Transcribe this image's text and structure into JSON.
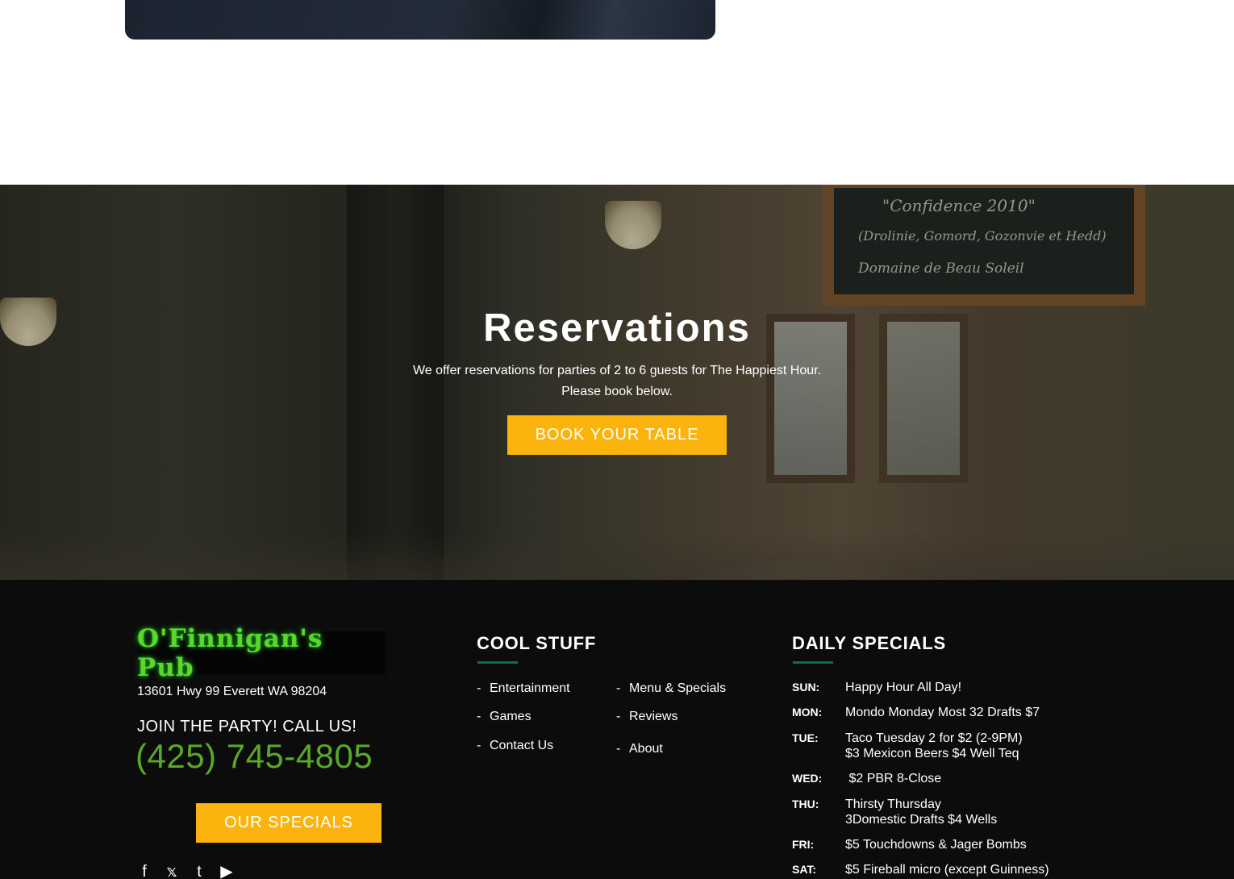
{
  "hero": {
    "title": "Reservations",
    "subtitle_line1": "We offer reservations for parties of 2 to 6 guests for The Happiest Hour.",
    "subtitle_line2": "Please book below.",
    "book_button": "BOOK YOUR TABLE"
  },
  "footer": {
    "logo_text": "O'Finnigan's Pub",
    "address": "13601 Hwy 99 Everett WA 98204",
    "call_label": "JOIN THE PARTY! CALL US!",
    "phone": "(425) 745-4805",
    "specials_button": "OUR SPECIALS",
    "socials": [
      "facebook-icon",
      "twitter-icon",
      "tumblr-icon",
      "youtube-icon"
    ],
    "cool_stuff": {
      "title": "COOL STUFF",
      "links": [
        "Entertainment",
        "Menu & Specials",
        "Games",
        "Reviews",
        "Contact Us",
        "About"
      ]
    },
    "daily_specials": {
      "title": "DAILY SPECIALS",
      "rows": [
        {
          "day": "SUN:",
          "deal": "Happy Hour All Day!",
          "deal2": ""
        },
        {
          "day": "MON:",
          "deal": "Mondo Monday Most 32 Drafts $7",
          "deal2": ""
        },
        {
          "day": "TUE:",
          "deal": "Taco Tuesday 2 for $2 (2-9PM)",
          "deal2": "$3 Mexicon Beers $4 Well Teq"
        },
        {
          "day": "WED:",
          "deal": " $2 PBR 8-Close",
          "deal2": ""
        },
        {
          "day": "THU:",
          "deal": "Thirsty Thursday",
          "deal2": "3Domestic Drafts $4 Wells"
        },
        {
          "day": "FRI:",
          "deal": "$5 Touchdowns & Jager Bombs",
          "deal2": ""
        },
        {
          "day": "SAT:",
          "deal": "$5 Fireball micro (except Guinness)",
          "deal2": ""
        }
      ]
    }
  },
  "colors": {
    "accent_yellow": "#fbb40e",
    "phone_green": "#5aa72a",
    "underline_green": "#0f6e4e",
    "footer_bg": "#0c0c0c"
  }
}
